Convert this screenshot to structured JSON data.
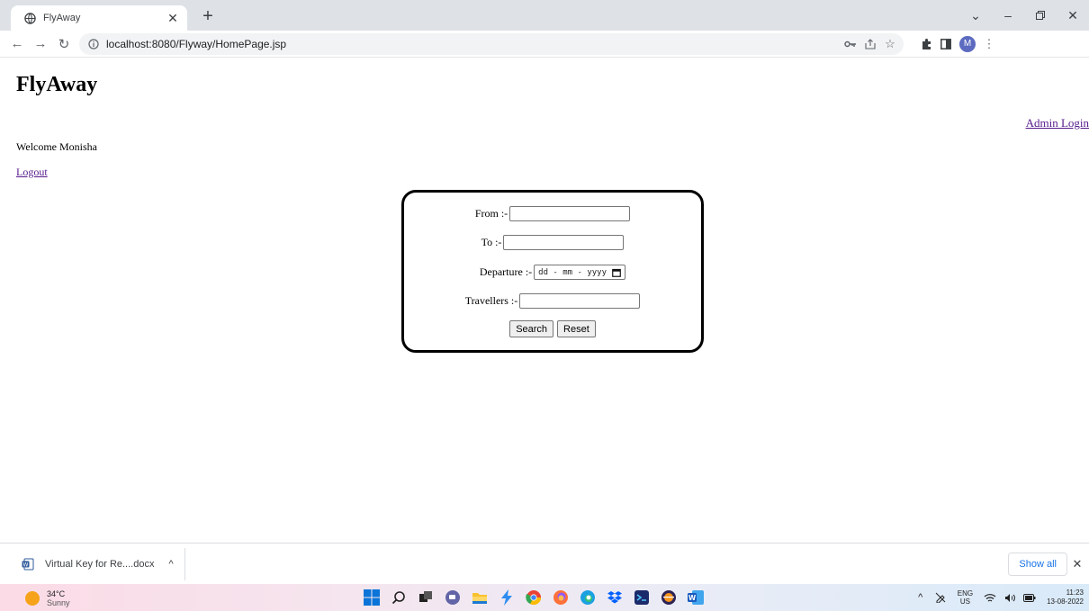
{
  "browser": {
    "tab_title": "FlyAway",
    "url": "localhost:8080/Flyway/HomePage.jsp",
    "profile_initial": "M"
  },
  "page": {
    "site_title": "FlyAway",
    "admin_login": "Admin Login",
    "welcome": "Welcome Monisha",
    "logout": "Logout"
  },
  "form": {
    "from_label": "From :-",
    "from_value": "",
    "to_label": "To :-",
    "to_value": "",
    "departure_label": "Departure :-",
    "departure_placeholder": "dd - mm - yyyy",
    "travellers_label": "Travellers :-",
    "travellers_value": "",
    "search_label": "Search",
    "reset_label": "Reset"
  },
  "downloads": {
    "file_name": "Virtual Key for Re....docx",
    "show_all": "Show all"
  },
  "taskbar": {
    "temperature": "34°C",
    "condition": "Sunny",
    "lang_primary": "ENG",
    "lang_secondary": "US",
    "time": "11:23",
    "date": "13-08-2022"
  },
  "colors": {
    "link_visited": "#551a8b",
    "accent": "#1a73e8",
    "tabbar_bg": "#dee1e6"
  }
}
